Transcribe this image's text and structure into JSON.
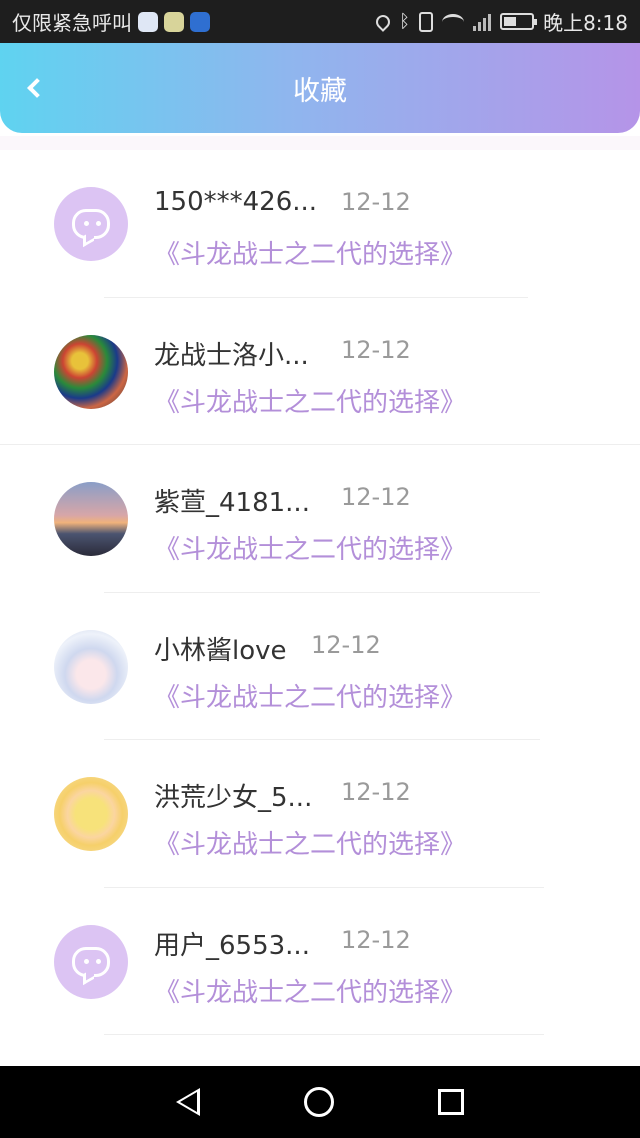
{
  "status_bar": {
    "left_text": "仅限紧急呼叫",
    "time": "晚上8:18",
    "icons": [
      "baidu-icon",
      "chat-icon",
      "shield-icon",
      "location-icon",
      "bluetooth-icon",
      "vibrate-icon",
      "wifi-icon",
      "signal-icon",
      "battery-icon"
    ]
  },
  "header": {
    "title": "收藏",
    "back_icon": "chevron-left-icon",
    "gradient_colors": [
      "#5fd3f0",
      "#b594e8"
    ]
  },
  "favorites": [
    {
      "name": "150***426...",
      "date": "12-12",
      "book": "《斗龙战士之二代的选择》",
      "avatar": "default-chat-avatar"
    },
    {
      "name": "龙战士洛小...",
      "date": "12-12",
      "book": "《斗龙战士之二代的选择》",
      "avatar": "user-photo-avatar"
    },
    {
      "name": "紫萱_4181...",
      "date": "12-12",
      "book": "《斗龙战士之二代的选择》",
      "avatar": "user-photo-avatar"
    },
    {
      "name": "小林酱love",
      "date": "12-12",
      "book": "《斗龙战士之二代的选择》",
      "avatar": "user-photo-avatar"
    },
    {
      "name": "洪荒少女_5...",
      "date": "12-12",
      "book": "《斗龙战士之二代的选择》",
      "avatar": "user-photo-avatar"
    },
    {
      "name": "用户_6553...",
      "date": "12-12",
      "book": "《斗龙战士之二代的选择》",
      "avatar": "default-chat-avatar"
    }
  ],
  "colors": {
    "book_title": "#b38fd9",
    "default_avatar_bg": "#dcc4f3"
  },
  "nav_bar": {
    "icons": [
      "nav-back-icon",
      "nav-home-icon",
      "nav-recent-icon"
    ]
  }
}
